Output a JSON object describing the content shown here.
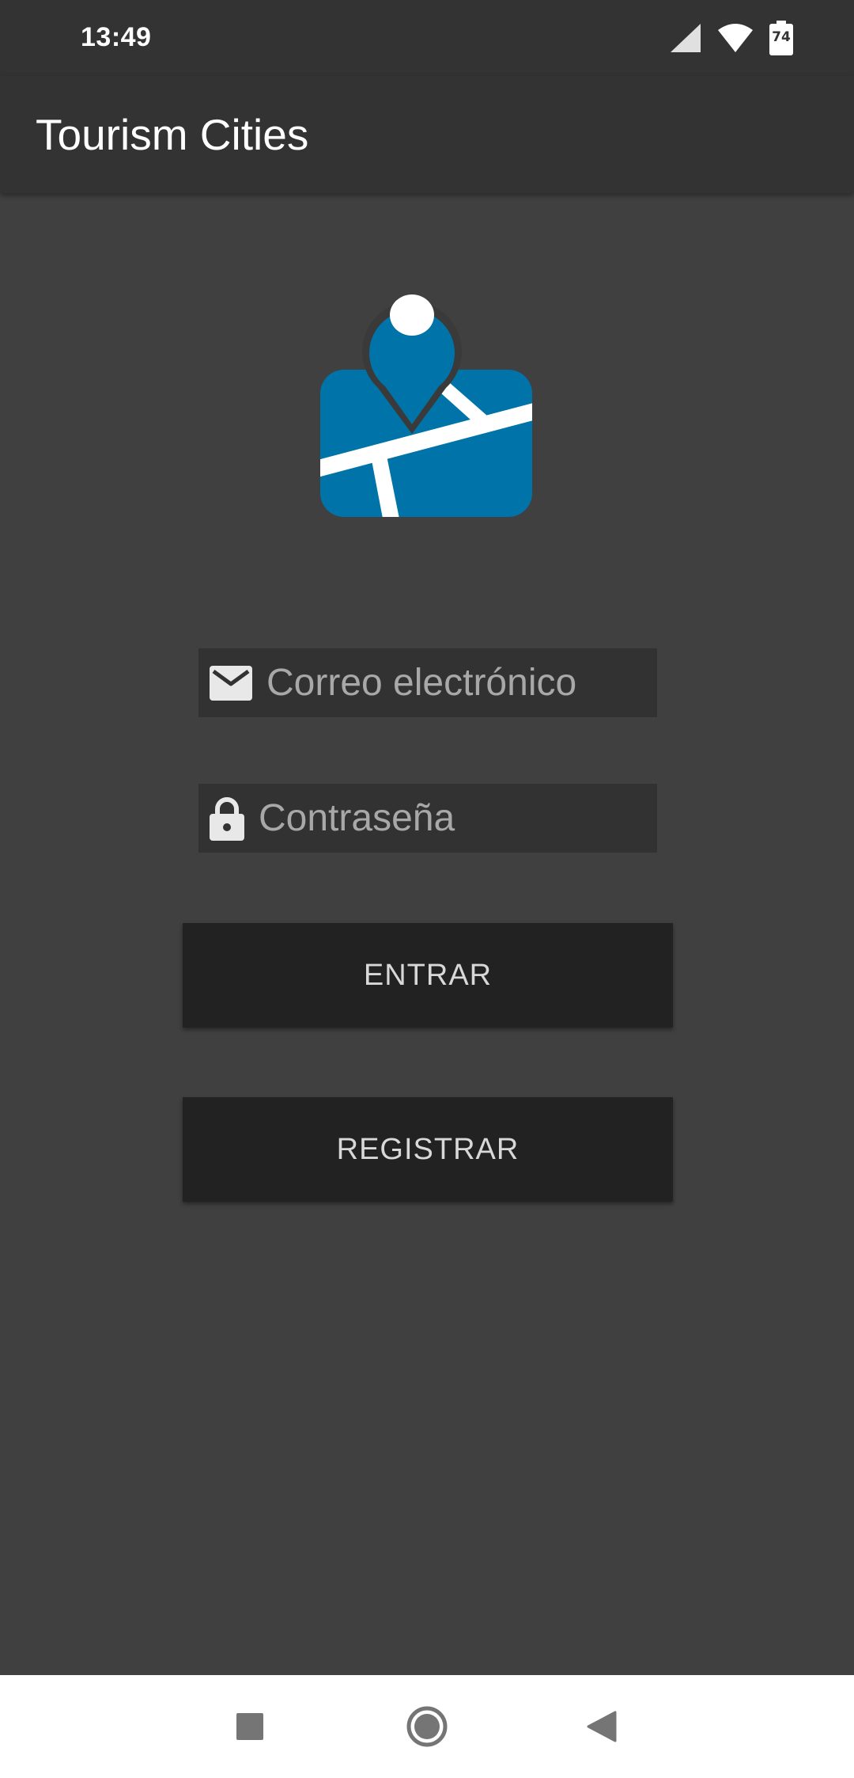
{
  "status_bar": {
    "time": "13:49",
    "battery_level": "74",
    "icons": [
      "cellular-signal-icon",
      "wifi-icon",
      "battery-icon"
    ]
  },
  "app_bar": {
    "title": "Tourism Cities"
  },
  "logo": {
    "icon": "map-location-icon",
    "accent_color": "#0073A8"
  },
  "login_form": {
    "email": {
      "icon": "mail-icon",
      "placeholder": "Correo electrónico",
      "value": ""
    },
    "password": {
      "icon": "lock-icon",
      "placeholder": "Contraseña",
      "value": ""
    },
    "login_button_label": "ENTRAR",
    "register_button_label": "REGISTRAR"
  },
  "nav_bar": {
    "buttons": [
      "recents-square-icon",
      "home-circle-icon",
      "back-triangle-icon"
    ]
  },
  "colors": {
    "background": "#404040",
    "app_bar": "#333333",
    "field_background": "#323232",
    "button_background": "#222222",
    "accent": "#0073A8"
  }
}
